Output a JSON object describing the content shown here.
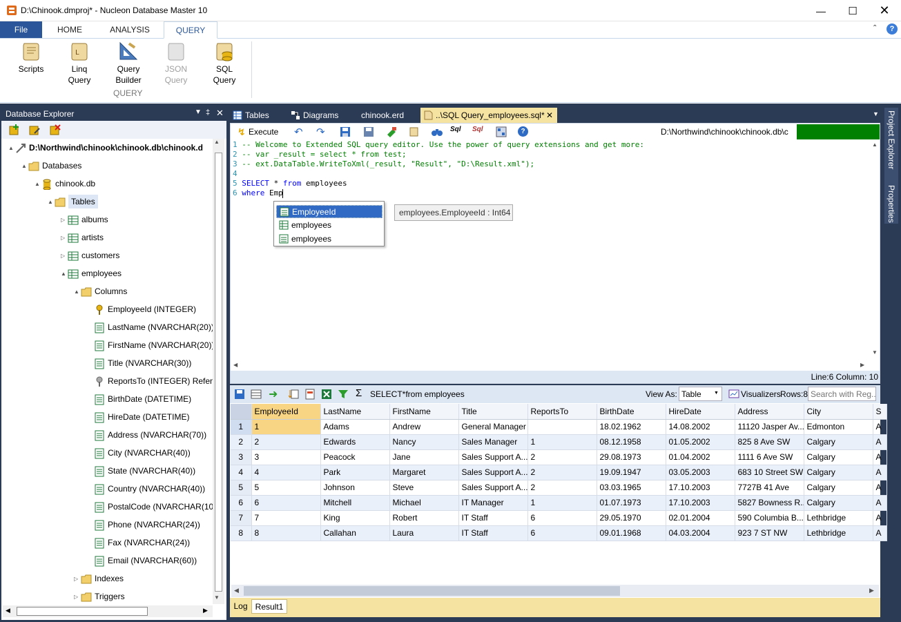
{
  "window": {
    "title": "D:\\Chinook.dmproj* - Nucleon Database Master 10"
  },
  "ribbon": {
    "tabs": [
      "File",
      "HOME",
      "ANALYSIS",
      "QUERY"
    ],
    "group_label": "QUERY",
    "buttons": [
      {
        "l1": "Scripts",
        "l2": ""
      },
      {
        "l1": "Linq",
        "l2": "Query"
      },
      {
        "l1": "Query",
        "l2": "Builder"
      },
      {
        "l1": "JSON",
        "l2": "Query"
      },
      {
        "l1": "SQL",
        "l2": "Query"
      }
    ]
  },
  "explorer": {
    "title": "Database Explorer",
    "tree": [
      {
        "label": "D:\\Northwind\\chinook\\chinook.db\\chinook.d",
        "icon": "connection-icon",
        "level": 0,
        "exp": "▲",
        "bold": true
      },
      {
        "label": "Databases",
        "icon": "folder-icon",
        "level": 1,
        "exp": "▲"
      },
      {
        "label": "chinook.db",
        "icon": "database-icon",
        "level": 2,
        "exp": "▲"
      },
      {
        "label": "Tables",
        "icon": "folder-icon",
        "level": 3,
        "exp": "▲",
        "selected": true
      },
      {
        "label": "albums",
        "icon": "table-icon",
        "level": 4,
        "exp": "▷"
      },
      {
        "label": "artists",
        "icon": "table-icon",
        "level": 4,
        "exp": "▷"
      },
      {
        "label": "customers",
        "icon": "table-icon",
        "level": 4,
        "exp": "▷"
      },
      {
        "label": "employees",
        "icon": "table-icon",
        "level": 4,
        "exp": "▲"
      },
      {
        "label": "Columns",
        "icon": "folder-icon",
        "level": 5,
        "exp": "▲"
      },
      {
        "label": "EmployeeId (INTEGER)",
        "icon": "key-icon",
        "level": 6,
        "exp": ""
      },
      {
        "label": "LastName (NVARCHAR(20))",
        "icon": "column-icon",
        "level": 6,
        "exp": ""
      },
      {
        "label": "FirstName (NVARCHAR(20))",
        "icon": "column-icon",
        "level": 6,
        "exp": ""
      },
      {
        "label": "Title (NVARCHAR(30))",
        "icon": "column-icon",
        "level": 6,
        "exp": ""
      },
      {
        "label": "ReportsTo (INTEGER) Refen",
        "icon": "foreign-key-icon",
        "level": 6,
        "exp": ""
      },
      {
        "label": "BirthDate (DATETIME)",
        "icon": "column-icon",
        "level": 6,
        "exp": ""
      },
      {
        "label": "HireDate (DATETIME)",
        "icon": "column-icon",
        "level": 6,
        "exp": ""
      },
      {
        "label": "Address (NVARCHAR(70))",
        "icon": "column-icon",
        "level": 6,
        "exp": ""
      },
      {
        "label": "City (NVARCHAR(40))",
        "icon": "column-icon",
        "level": 6,
        "exp": ""
      },
      {
        "label": "State (NVARCHAR(40))",
        "icon": "column-icon",
        "level": 6,
        "exp": ""
      },
      {
        "label": "Country (NVARCHAR(40))",
        "icon": "column-icon",
        "level": 6,
        "exp": ""
      },
      {
        "label": "PostalCode (NVARCHAR(10",
        "icon": "column-icon",
        "level": 6,
        "exp": ""
      },
      {
        "label": "Phone (NVARCHAR(24))",
        "icon": "column-icon",
        "level": 6,
        "exp": ""
      },
      {
        "label": "Fax (NVARCHAR(24))",
        "icon": "column-icon",
        "level": 6,
        "exp": ""
      },
      {
        "label": "Email (NVARCHAR(60))",
        "icon": "column-icon",
        "level": 6,
        "exp": ""
      },
      {
        "label": "Indexes",
        "icon": "folder-icon",
        "level": 5,
        "exp": "▷"
      },
      {
        "label": "Triggers",
        "icon": "folder-icon",
        "level": 5,
        "exp": "▷"
      }
    ]
  },
  "doc_tabs": [
    "Tables",
    "Diagrams",
    "chinook.erd",
    "..\\SQL Query_employees.sql*"
  ],
  "side_tabs": [
    "Project Explorer",
    "Properties"
  ],
  "editor": {
    "execute_label": "Execute",
    "path": "D:\\Northwind\\chinook\\chinook.db\\c",
    "lines": [
      {
        "n": "1",
        "parts": [
          {
            "t": "-- Welcome to Extended SQL query editor. Use the power of query extensions and get more:",
            "c": "cm"
          }
        ]
      },
      {
        "n": "2",
        "parts": [
          {
            "t": "-- var _result = select * from test;",
            "c": "cm"
          }
        ]
      },
      {
        "n": "3",
        "parts": [
          {
            "t": "-- ext.DataTable.WriteToXml(_result, \"Result\", \"D:\\Result.xml\");",
            "c": "cm"
          }
        ]
      },
      {
        "n": "4",
        "parts": []
      },
      {
        "n": "5",
        "parts": [
          {
            "t": "SELECT",
            "c": "kw"
          },
          {
            "t": " * ",
            "c": ""
          },
          {
            "t": "from",
            "c": "kw"
          },
          {
            "t": " employees",
            "c": ""
          }
        ]
      },
      {
        "n": "6",
        "parts": [
          {
            "t": "where",
            "c": "kw"
          },
          {
            "t": " Emp",
            "c": ""
          }
        ]
      }
    ],
    "autocomplete": [
      {
        "label": "EmployeeId",
        "icon": "column-icon",
        "selected": true
      },
      {
        "label": "employees",
        "icon": "table-icon",
        "selected": false
      },
      {
        "label": "employees",
        "icon": "column-icon",
        "selected": false
      }
    ],
    "tooltip": "employees.EmployeeId : Int64",
    "status": "Line:6 Column: 10"
  },
  "results": {
    "query_text": "SELECT*from employees",
    "view_as_label": "View As:",
    "view_as_value": "Table",
    "visualizers_label": "Visualizers",
    "rows_label": "Rows:8",
    "search_placeholder": "Search with Reg...",
    "columns": [
      "EmployeeId",
      "LastName",
      "FirstName",
      "Title",
      "ReportsTo",
      "BirthDate",
      "HireDate",
      "Address",
      "City",
      "S"
    ],
    "rows": [
      [
        "1",
        "Adams",
        "Andrew",
        "General Manager",
        "",
        "18.02.1962",
        "14.08.2002",
        "11120 Jasper Av...",
        "Edmonton",
        "A"
      ],
      [
        "2",
        "Edwards",
        "Nancy",
        "Sales Manager",
        "1",
        "08.12.1958",
        "01.05.2002",
        "825 8 Ave SW",
        "Calgary",
        "A"
      ],
      [
        "3",
        "Peacock",
        "Jane",
        "Sales Support A...",
        "2",
        "29.08.1973",
        "01.04.2002",
        "1111 6 Ave SW",
        "Calgary",
        "A"
      ],
      [
        "4",
        "Park",
        "Margaret",
        "Sales Support A...",
        "2",
        "19.09.1947",
        "03.05.2003",
        "683 10 Street SW",
        "Calgary",
        "A"
      ],
      [
        "5",
        "Johnson",
        "Steve",
        "Sales Support A...",
        "2",
        "03.03.1965",
        "17.10.2003",
        "7727B 41 Ave",
        "Calgary",
        "A"
      ],
      [
        "6",
        "Mitchell",
        "Michael",
        "IT Manager",
        "1",
        "01.07.1973",
        "17.10.2003",
        "5827 Bowness R...",
        "Calgary",
        "A"
      ],
      [
        "7",
        "King",
        "Robert",
        "IT Staff",
        "6",
        "29.05.1970",
        "02.01.2004",
        "590 Columbia B...",
        "Lethbridge",
        "A"
      ],
      [
        "8",
        "Callahan",
        "Laura",
        "IT Staff",
        "6",
        "09.01.1968",
        "04.03.2004",
        "923 7 ST NW",
        "Lethbridge",
        "A"
      ]
    ],
    "row_headers": [
      "1",
      "2",
      "3",
      "4",
      "5",
      "6",
      "7",
      "8"
    ],
    "bottom_tabs": [
      "Log",
      "Result1"
    ]
  },
  "colors": {
    "accent": "#2b579a",
    "dark": "#2b3a55",
    "active_tab": "#f5e3a1",
    "execute_indicator": "#008000",
    "selection": "#316ac5"
  }
}
